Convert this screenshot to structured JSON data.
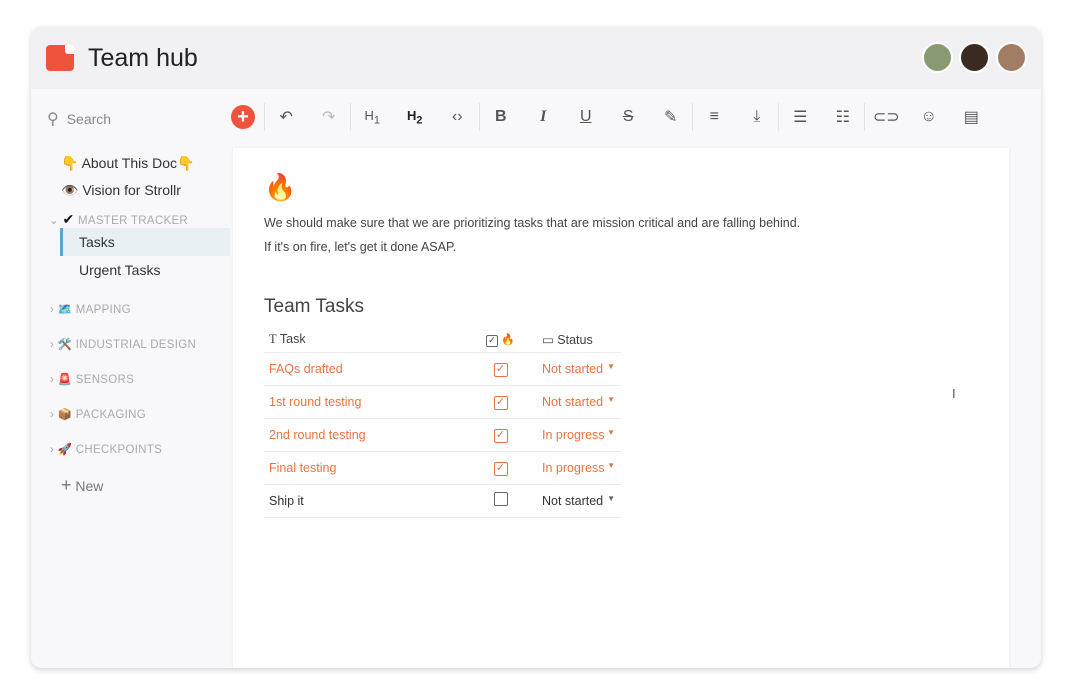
{
  "header": {
    "title": "Team hub"
  },
  "search": {
    "placeholder": "Search"
  },
  "sidebar": {
    "pages": [
      {
        "emoji": "👇",
        "label": "About This Doc",
        "suffix": "👇"
      },
      {
        "emoji": "👁️",
        "label": "Vision for Strollr"
      }
    ],
    "master": {
      "emoji": "✔",
      "label": "MASTER TRACKER",
      "children": [
        "Tasks",
        "Urgent Tasks"
      ]
    },
    "sections": [
      {
        "emoji": "🗺️",
        "label": "MAPPING"
      },
      {
        "emoji": "🛠️",
        "label": "INDUSTRIAL DESIGN"
      },
      {
        "emoji": "🚨",
        "label": "SENSORS"
      },
      {
        "emoji": "📦",
        "label": "PACKAGING"
      },
      {
        "emoji": "🚀",
        "label": "CHECKPOINTS"
      }
    ],
    "new_label": "New"
  },
  "doc": {
    "emoji": "🔥",
    "lines": [
      "We should make sure that we are prioritizing tasks that are mission critical and are falling behind.",
      "If it's on fire, let's get it done ASAP."
    ],
    "heading": "Team Tasks",
    "columns": {
      "task": "Task",
      "fire": "🔥",
      "status": "Status"
    },
    "rows": [
      {
        "task": "FAQs drafted",
        "checked": true,
        "status": "Not started"
      },
      {
        "task": "1st round testing",
        "checked": true,
        "status": "Not started"
      },
      {
        "task": "2nd round testing",
        "checked": true,
        "status": "In progress"
      },
      {
        "task": "Final testing",
        "checked": true,
        "status": "In progress"
      },
      {
        "task": "Ship it",
        "checked": false,
        "status": "Not started"
      }
    ]
  },
  "colors": {
    "accent": "#f0533d",
    "highlight": "#e8743f"
  }
}
